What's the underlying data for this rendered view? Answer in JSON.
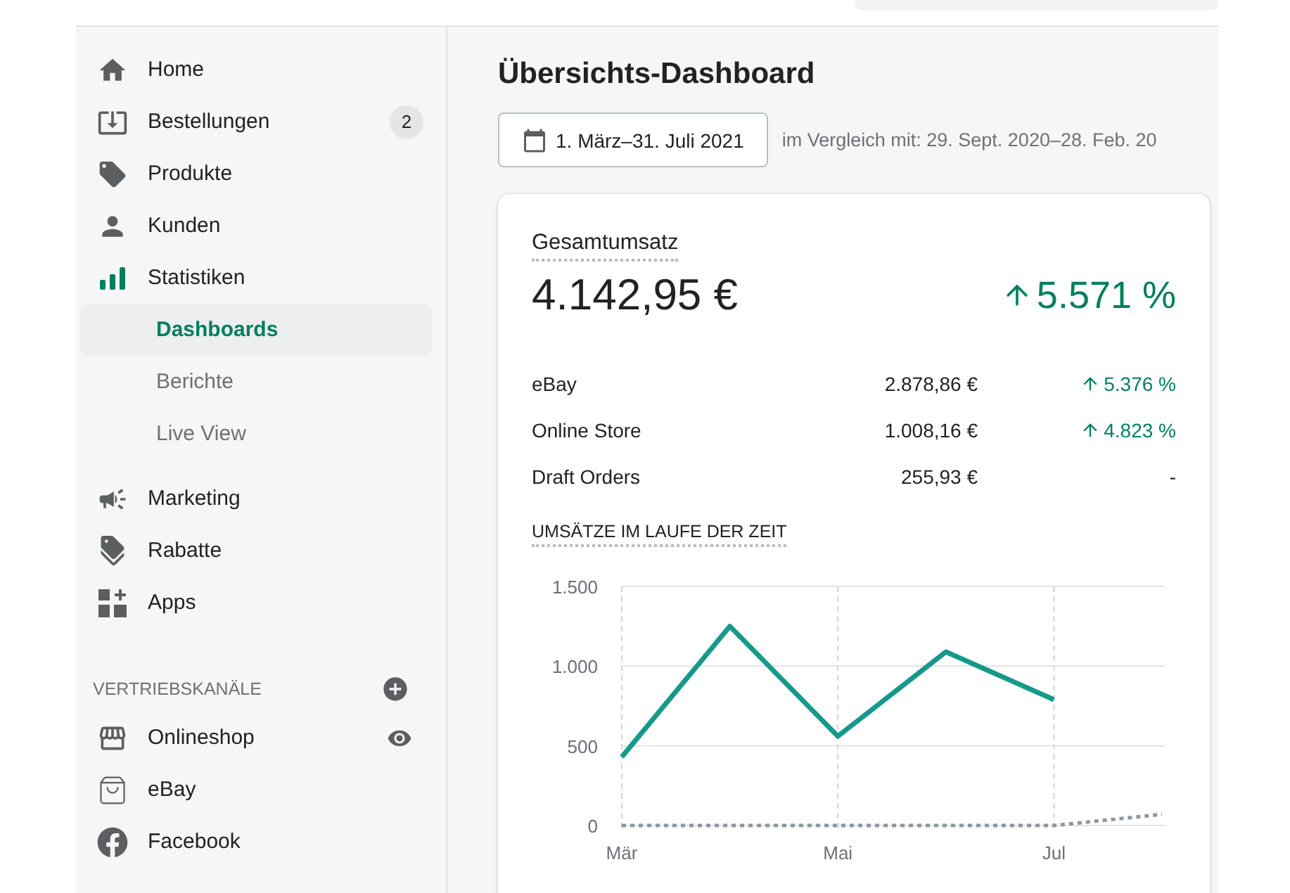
{
  "sidebar": {
    "items": [
      {
        "label": "Home",
        "selected": false
      },
      {
        "label": "Bestellungen",
        "selected": false,
        "badge": "2"
      },
      {
        "label": "Produkte",
        "selected": false
      },
      {
        "label": "Kunden",
        "selected": false
      },
      {
        "label": "Statistiken",
        "selected": false,
        "expanded": true,
        "children": [
          {
            "label": "Dashboards",
            "selected": true
          },
          {
            "label": "Berichte",
            "selected": false
          },
          {
            "label": "Live View",
            "selected": false
          }
        ]
      },
      {
        "label": "Marketing",
        "selected": false
      },
      {
        "label": "Rabatte",
        "selected": false
      },
      {
        "label": "Apps",
        "selected": false
      }
    ],
    "channels": {
      "title": "VERTRIEBSKANÄLE",
      "items": [
        {
          "label": "Onlineshop",
          "selected": false
        },
        {
          "label": "eBay",
          "selected": false
        },
        {
          "label": "Facebook",
          "selected": false
        }
      ]
    }
  },
  "page": {
    "title": "Übersichts-Dashboard",
    "date_range": "1. März–31. Juli 2021",
    "comparison": "im Vergleich mit: 29. Sept. 2020–28. Feb. 20"
  },
  "card": {
    "title": "Gesamtumsatz",
    "total": "4.142,95 €",
    "change": "5.571 %",
    "rows": [
      {
        "name": "eBay",
        "amount": "2.878,86 €",
        "change": "5.376 %"
      },
      {
        "name": "Online Store",
        "amount": "1.008,16 €",
        "change": "4.823 %"
      },
      {
        "name": "Draft Orders",
        "amount": "255,93 €",
        "change": "-"
      }
    ],
    "chart_title": "UMSÄTZE IM LAUFE DER ZEIT",
    "chart_data": {
      "type": "line",
      "grid": true,
      "categories": [
        "Mär",
        null,
        "Mai",
        null,
        "Jul",
        null
      ],
      "ylim": [
        0,
        1500
      ],
      "yticks": [
        {
          "value": 0,
          "label": "0"
        },
        {
          "value": 500,
          "label": "500"
        },
        {
          "value": 1000,
          "label": "1.000"
        },
        {
          "value": 1500,
          "label": "1.500"
        }
      ],
      "series": [
        {
          "color": "#16998b",
          "line_style": "solid",
          "values": [
            430,
            1250,
            560,
            1090,
            790,
            null
          ]
        },
        {
          "color": "#8d97a3",
          "line_style": "dotted",
          "values": [
            0,
            0,
            0,
            0,
            0,
            70
          ]
        }
      ]
    }
  }
}
